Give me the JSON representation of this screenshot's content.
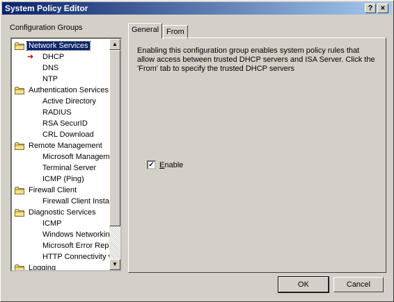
{
  "window": {
    "title": "System Policy Editor"
  },
  "title_buttons": {
    "help": "?",
    "close": "×"
  },
  "left": {
    "label": "Configuration Groups"
  },
  "tree": [
    {
      "text": "Network Services",
      "level": 0,
      "folder": true,
      "selected": true
    },
    {
      "text": "DHCP",
      "level": 1,
      "arrow": true
    },
    {
      "text": "DNS",
      "level": 1
    },
    {
      "text": "NTP",
      "level": 1
    },
    {
      "text": "Authentication Services",
      "level": 0,
      "folder": true
    },
    {
      "text": "Active Directory",
      "level": 1
    },
    {
      "text": "RADIUS",
      "level": 1
    },
    {
      "text": "RSA SecurID",
      "level": 1
    },
    {
      "text": "CRL Download",
      "level": 1
    },
    {
      "text": "Remote Management",
      "level": 0,
      "folder": true
    },
    {
      "text": "Microsoft Manageme",
      "level": 1
    },
    {
      "text": "Terminal Server",
      "level": 1
    },
    {
      "text": "ICMP (Ping)",
      "level": 1
    },
    {
      "text": "Firewall Client",
      "level": 0,
      "folder": true
    },
    {
      "text": "Firewall Client Install",
      "level": 1
    },
    {
      "text": "Diagnostic Services",
      "level": 0,
      "folder": true
    },
    {
      "text": "ICMP",
      "level": 1
    },
    {
      "text": "Windows Networking",
      "level": 1
    },
    {
      "text": "Microsoft Error Repo",
      "level": 1
    },
    {
      "text": "HTTP Connectivity ve",
      "level": 1
    },
    {
      "text": "Logging",
      "level": 0,
      "folder": true
    }
  ],
  "tabs": {
    "general": "General",
    "from": "From"
  },
  "general": {
    "description": "Enabling this configuration group enables system policy rules that allow access between trusted DHCP servers and ISA Server. Click the 'From' tab to specify the trusted DHCP servers",
    "enable_label": "Enable",
    "enable_checked": true
  },
  "buttons": {
    "ok": "OK",
    "cancel": "Cancel"
  }
}
